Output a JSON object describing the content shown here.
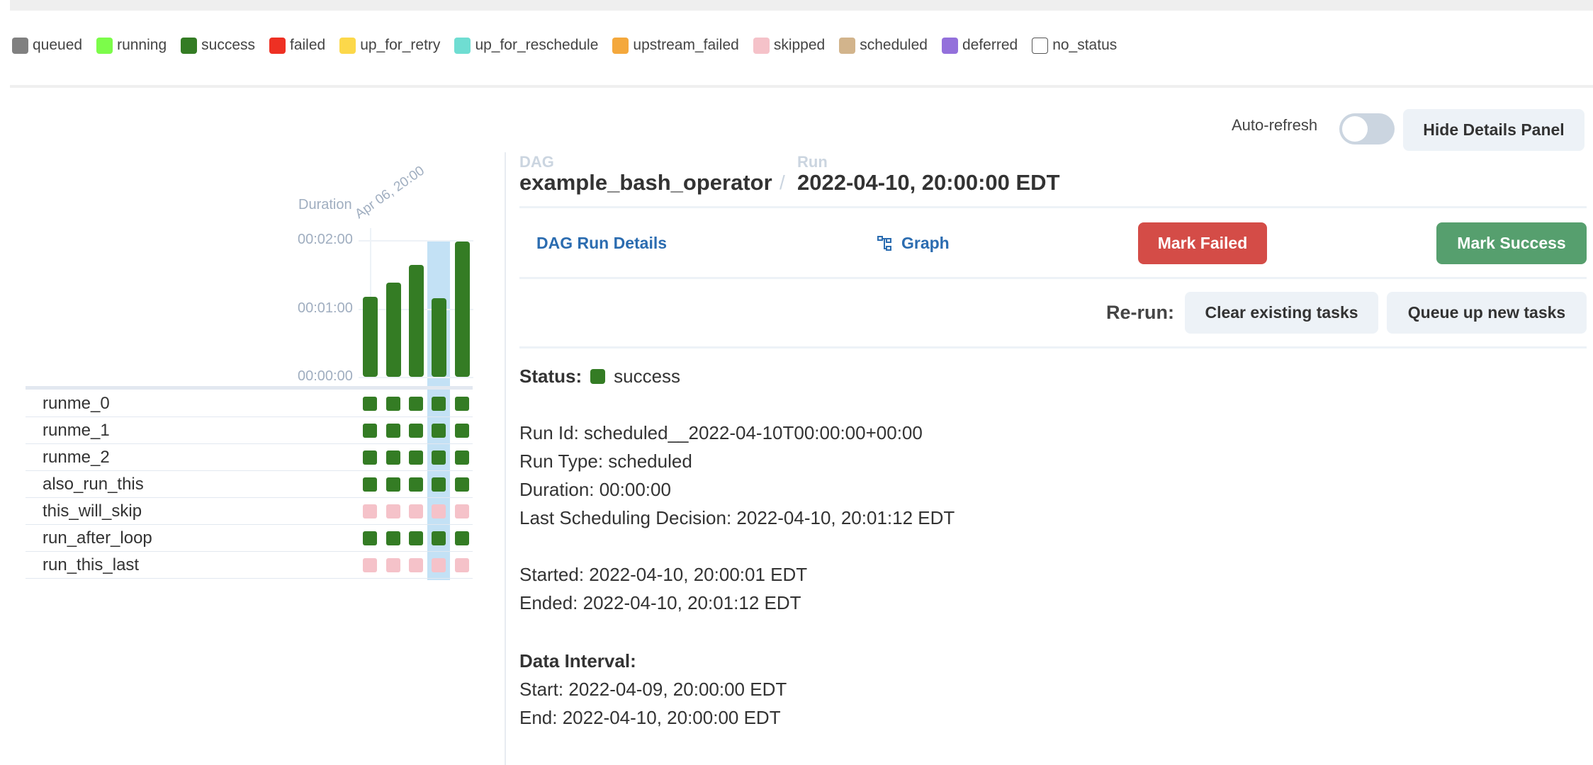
{
  "legend": [
    {
      "label": "queued",
      "color": "#808080"
    },
    {
      "label": "running",
      "color": "#7cfc4a"
    },
    {
      "label": "success",
      "color": "#347c24"
    },
    {
      "label": "failed",
      "color": "#ee3023"
    },
    {
      "label": "up_for_retry",
      "color": "#fcd84a"
    },
    {
      "label": "up_for_reschedule",
      "color": "#6fddd2"
    },
    {
      "label": "upstream_failed",
      "color": "#f4a83c"
    },
    {
      "label": "skipped",
      "color": "#f5c2c9"
    },
    {
      "label": "scheduled",
      "color": "#d2b48c"
    },
    {
      "label": "deferred",
      "color": "#9370db"
    },
    {
      "label": "no_status",
      "color": "#ffffff"
    }
  ],
  "header": {
    "auto_refresh_label": "Auto-refresh",
    "auto_refresh_on": false,
    "hide_details_label": "Hide Details Panel"
  },
  "grid": {
    "duration_label": "Duration",
    "date_label": "Apr 06, 20:00",
    "y_ticks": [
      "00:02:00",
      "00:01:00",
      "00:00:00"
    ],
    "run_durations_seconds": [
      70,
      83,
      98,
      69,
      119
    ],
    "selected_run_index": 3,
    "tasks": [
      {
        "name": "runme_0",
        "states": [
          "success",
          "success",
          "success",
          "success",
          "success"
        ]
      },
      {
        "name": "runme_1",
        "states": [
          "success",
          "success",
          "success",
          "success",
          "success"
        ]
      },
      {
        "name": "runme_2",
        "states": [
          "success",
          "success",
          "success",
          "success",
          "success"
        ]
      },
      {
        "name": "also_run_this",
        "states": [
          "success",
          "success",
          "success",
          "success",
          "success"
        ]
      },
      {
        "name": "this_will_skip",
        "states": [
          "skipped",
          "skipped",
          "skipped",
          "skipped",
          "skipped"
        ]
      },
      {
        "name": "run_after_loop",
        "states": [
          "success",
          "success",
          "success",
          "success",
          "success"
        ]
      },
      {
        "name": "run_this_last",
        "states": [
          "skipped",
          "skipped",
          "skipped",
          "skipped",
          "skipped"
        ]
      }
    ]
  },
  "details": {
    "dag_label": "DAG",
    "dag_name": "example_bash_operator",
    "run_label": "Run",
    "run_name": "2022-04-10, 20:00:00 EDT",
    "tab_run_details": "DAG Run Details",
    "tab_graph": "Graph",
    "mark_failed": "Mark Failed",
    "mark_success": "Mark Success",
    "rerun_label": "Re-run:",
    "clear_existing": "Clear existing tasks",
    "queue_new": "Queue up new tasks",
    "status_label": "Status:",
    "status_value": "success",
    "run_id": "Run Id: scheduled__2022-04-10T00:00:00+00:00",
    "run_type": "Run Type: scheduled",
    "duration": "Duration: 00:00:00",
    "last_sched": "Last Scheduling Decision: 2022-04-10, 20:01:12 EDT",
    "started": "Started: 2022-04-10, 20:00:01 EDT",
    "ended": "Ended: 2022-04-10, 20:01:12 EDT",
    "data_interval_label": "Data Interval:",
    "di_start": "Start: 2022-04-09, 20:00:00 EDT",
    "di_end": "End: 2022-04-10, 20:00:00 EDT"
  }
}
